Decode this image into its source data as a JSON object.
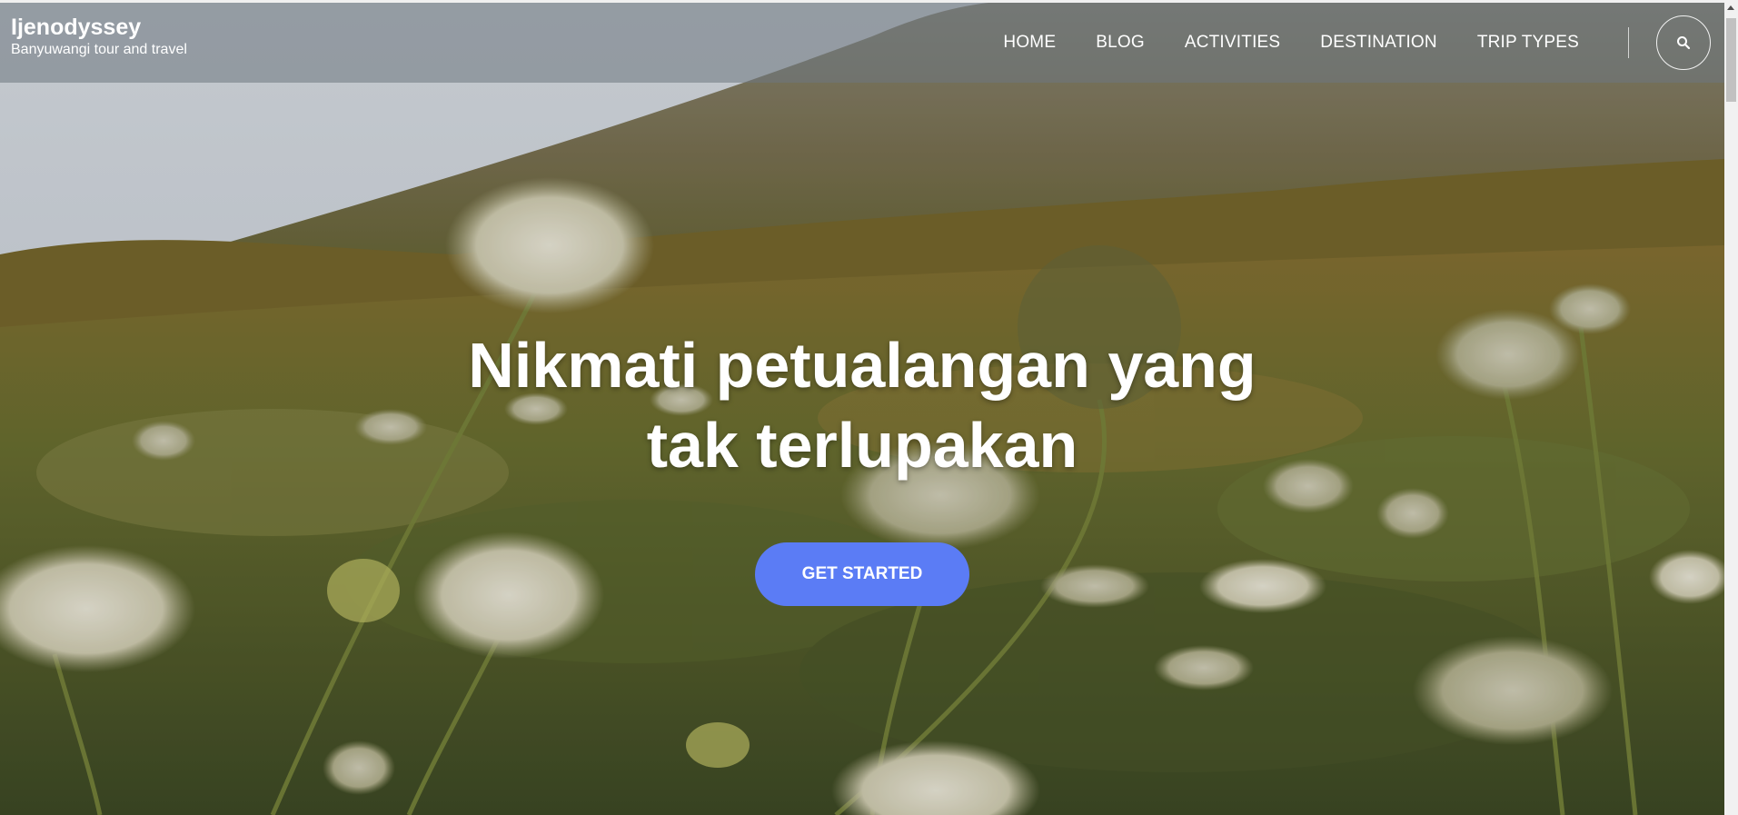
{
  "brand": {
    "name": "Ijenodyssey",
    "tagline": "Banyuwangi tour and travel"
  },
  "nav": {
    "items": [
      {
        "label": "HOME"
      },
      {
        "label": "BLOG"
      },
      {
        "label": "ACTIVITIES"
      },
      {
        "label": "DESTINATION"
      },
      {
        "label": "TRIP TYPES"
      }
    ],
    "search_icon": "search-icon"
  },
  "hero": {
    "title_line1": "Nikmati petualangan yang",
    "title_line2": "tak terlupakan",
    "cta_label": "GET STARTED"
  },
  "colors": {
    "accent": "#5b7cf5",
    "header_overlay": "rgba(110,118,128,0.55)",
    "text": "#ffffff"
  }
}
